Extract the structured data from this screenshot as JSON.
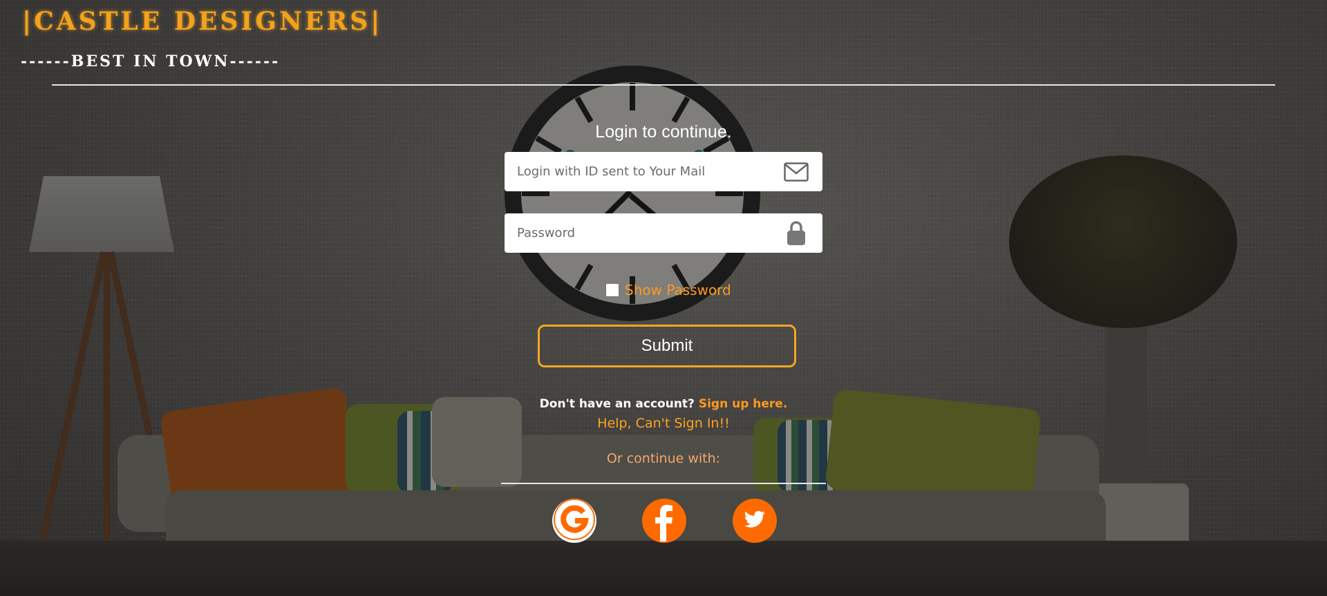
{
  "brand": {
    "title": "|CASTLE DESIGNERS|",
    "tagline": "------BEST IN TOWN------"
  },
  "login": {
    "heading": "Login to continue.",
    "email_placeholder": "Login with ID sent to Your Mail",
    "password_placeholder": "Password",
    "show_password_label": "Show Password",
    "submit_label": "Submit"
  },
  "links": {
    "no_account_text": "Don't have an account?",
    "signup_label": "Sign up here.",
    "help_label": "Help, Can't Sign In!!",
    "continue_with": "Or continue with:"
  },
  "social": {
    "google_icon": "google-icon",
    "facebook_icon": "facebook-icon",
    "twitter_icon": "twitter-icon"
  },
  "colors": {
    "accent": "#f5a623",
    "social_orange": "#ff6a00"
  }
}
